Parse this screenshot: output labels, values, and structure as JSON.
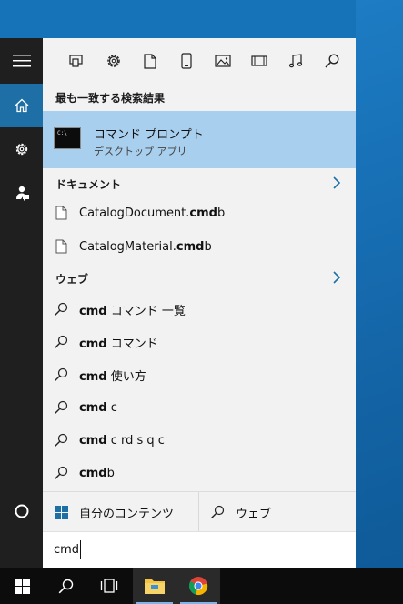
{
  "best_match": {
    "section_title": "最も一致する検索結果",
    "name": "コマンド プロンプト",
    "type": "デスクトップ アプリ",
    "icon_text": "C:\\_"
  },
  "documents": {
    "title": "ドキュメント",
    "items": [
      {
        "prefix": "CatalogDocument.",
        "match": "cmd",
        "suffix": "b"
      },
      {
        "prefix": "CatalogMaterial.",
        "match": "cmd",
        "suffix": "b"
      }
    ]
  },
  "web": {
    "title": "ウェブ",
    "items": [
      {
        "match": "cmd",
        "suffix": " コマンド 一覧"
      },
      {
        "match": "cmd",
        "suffix": " コマンド"
      },
      {
        "match": "cmd",
        "suffix": " 使い方"
      },
      {
        "match": "cmd",
        "suffix": " c"
      },
      {
        "match": "cmd",
        "suffix": " c rd s q c"
      },
      {
        "match": "cmd",
        "suffix": "b"
      }
    ]
  },
  "scopes": {
    "mine": "自分のコンテンツ",
    "web": "ウェブ"
  },
  "search": {
    "query": "cmd"
  },
  "filters": [
    "apps-icon",
    "settings-icon",
    "documents-icon",
    "phone-icon",
    "photos-icon",
    "videos-icon",
    "music-icon",
    "search-icon"
  ],
  "colors": {
    "accent": "#1d6fa5",
    "selection": "#a9cfee",
    "rail": "#1f1f1f",
    "panel": "#f2f2f2"
  }
}
